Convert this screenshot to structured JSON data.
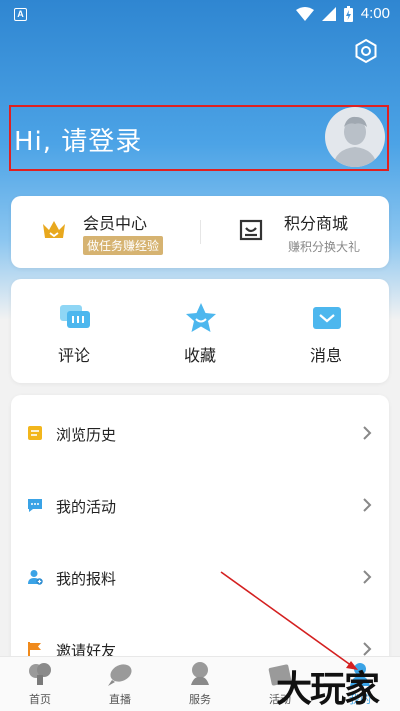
{
  "status_bar": {
    "app_badge": "A",
    "time": "4:00"
  },
  "header": {
    "login_text": "Hi, 请登录"
  },
  "membership": {
    "member_center": {
      "title": "会员中心",
      "subtitle": "做任务赚经验"
    },
    "points_mall": {
      "title": "积分商城",
      "subtitle": "赚积分换大礼"
    }
  },
  "quick_actions": [
    {
      "label": "评论",
      "icon": "comment-icon"
    },
    {
      "label": "收藏",
      "icon": "star-icon"
    },
    {
      "label": "消息",
      "icon": "message-icon"
    }
  ],
  "menu": [
    {
      "label": "浏览历史",
      "icon": "history-icon"
    },
    {
      "label": "我的活动",
      "icon": "activity-icon"
    },
    {
      "label": "我的报料",
      "icon": "report-icon"
    },
    {
      "label": "邀请好友",
      "icon": "flag-icon"
    }
  ],
  "tabbar": [
    {
      "label": "首页",
      "icon": "home-icon"
    },
    {
      "label": "直播",
      "icon": "live-icon"
    },
    {
      "label": "服务",
      "icon": "service-icon"
    },
    {
      "label": "活动",
      "icon": "activity-tab-icon"
    },
    {
      "label": "我的",
      "icon": "profile-tab-icon"
    }
  ],
  "watermark": "大玩家",
  "colors": {
    "accent": "#2f86d1",
    "gold": "#d6b371",
    "highlight": "#e02020"
  }
}
